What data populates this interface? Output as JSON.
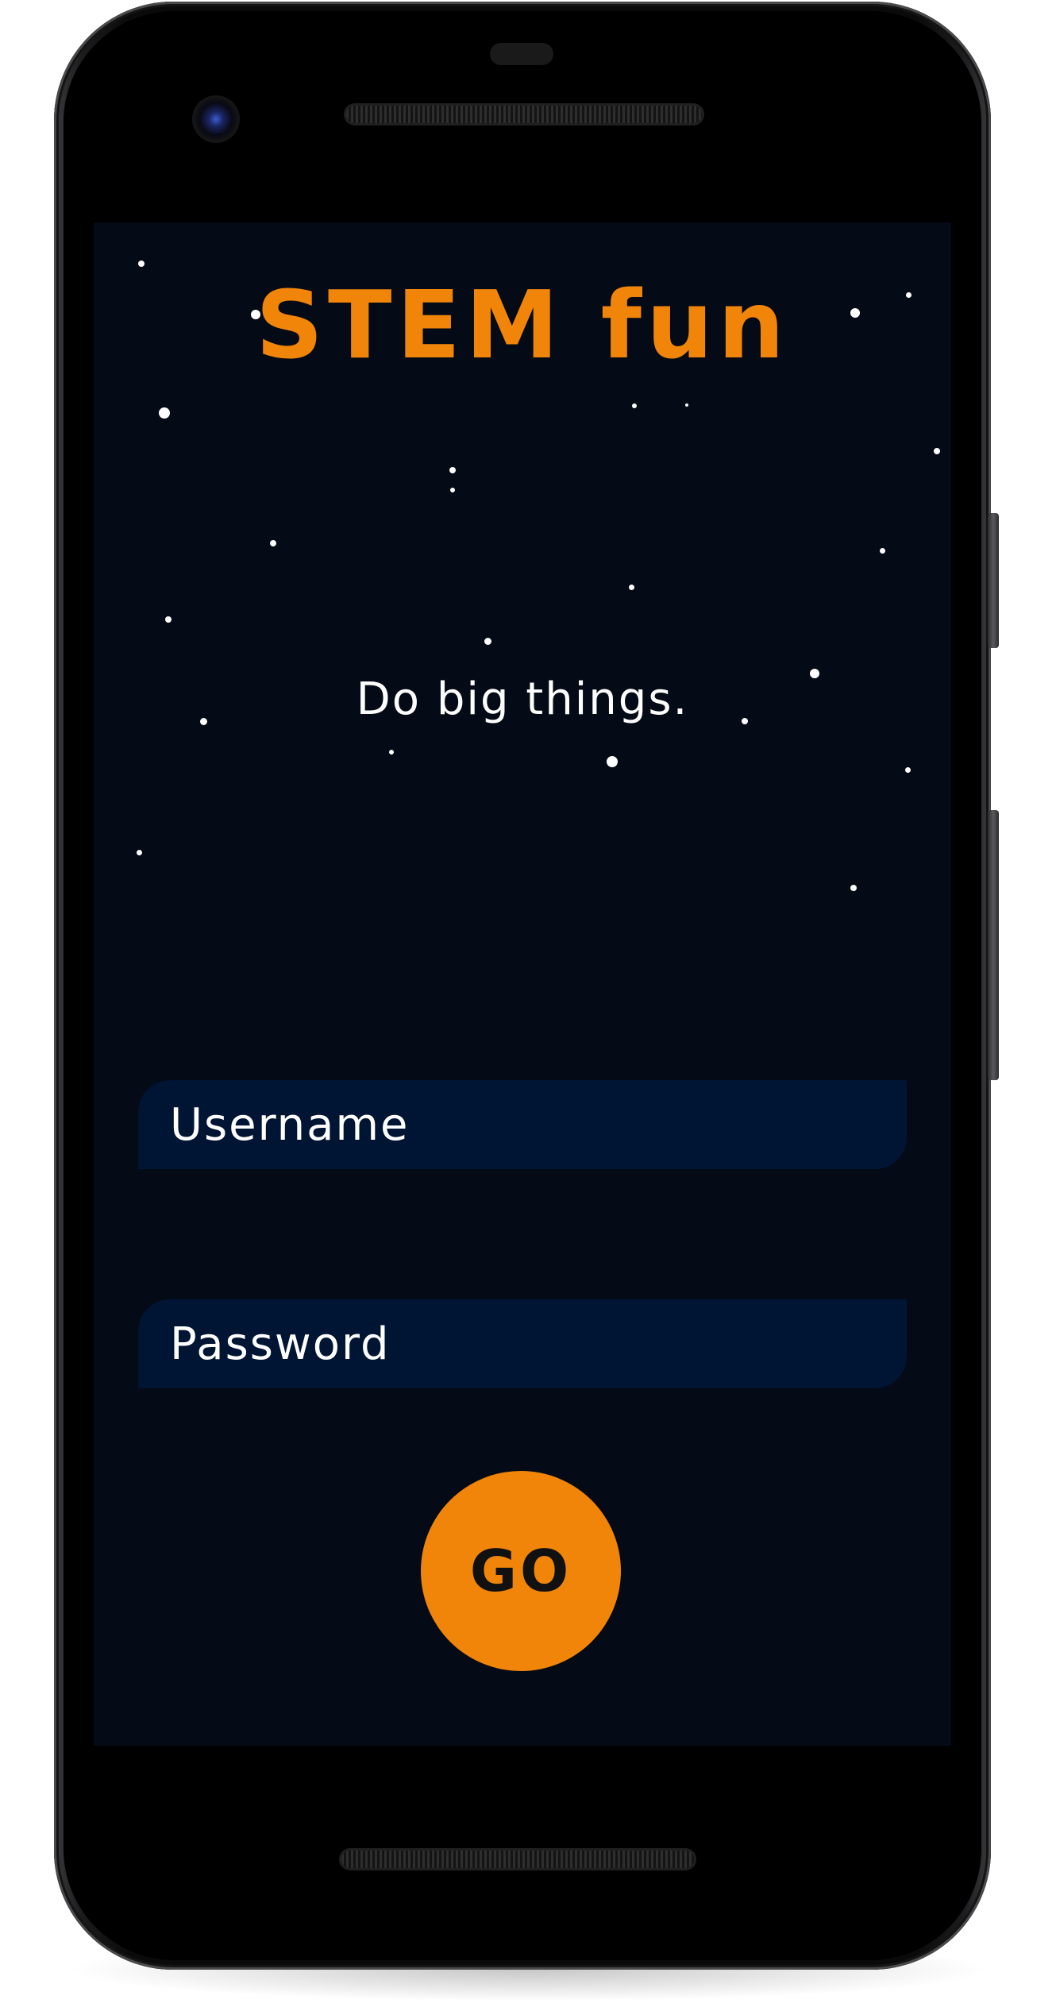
{
  "app": {
    "title": "STEM fun",
    "tagline": "Do big things."
  },
  "form": {
    "username_placeholder": "Username",
    "password_placeholder": "Password",
    "submit_label": "GO"
  },
  "colors": {
    "background": "#040a16",
    "accent": "#f0850a",
    "field_background": "#001534",
    "text": "#ffffff"
  }
}
